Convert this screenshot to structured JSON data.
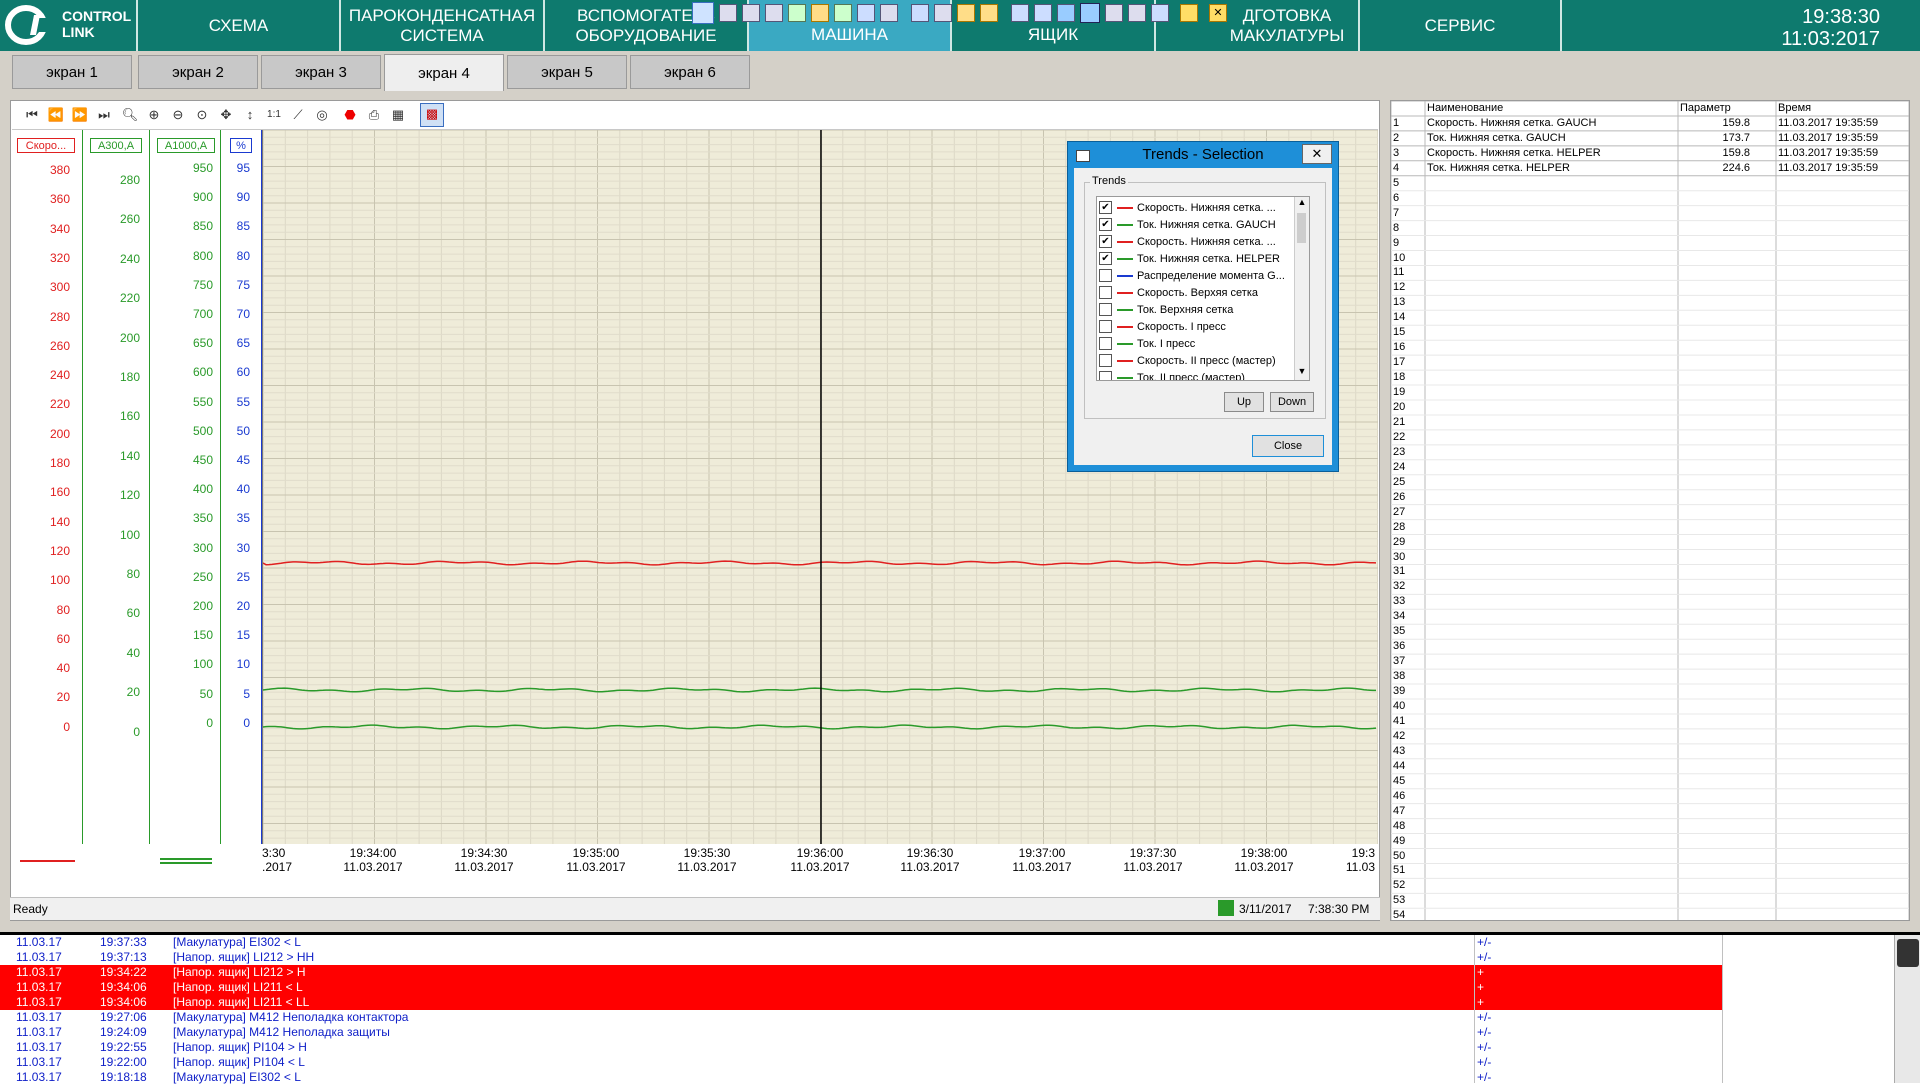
{
  "nav": {
    "logo": [
      "CONTROL",
      "LINK"
    ],
    "items": [
      {
        "label": "СХЕМА"
      },
      {
        "label": "ПАРОКОНДЕНСАТНАЯ СИСТЕМА"
      },
      {
        "label": "ВСПОМОГАТЕЛЬ ОБОРУДОВАНИЕ"
      },
      {
        "label": "МАШИНА",
        "active": true
      },
      {
        "label": "ЯЩИК"
      },
      {
        "label": "ДГОТОВКА МАКУЛАТУРЫ"
      },
      {
        "label": "СЕРВИС"
      }
    ],
    "time": "19:38:30",
    "date": "11:03:2017"
  },
  "tabs": [
    "экран 1",
    "экран 2",
    "экран 3",
    "экран 4",
    "экран 5",
    "экран 6"
  ],
  "active_tab": "экран 4",
  "axes": {
    "boxes": [
      "Скоро...",
      "A300,A",
      "A1000,A",
      "%"
    ],
    "axis1": [
      "380",
      "360",
      "340",
      "320",
      "300",
      "280",
      "260",
      "240",
      "220",
      "200",
      "180",
      "160",
      "140",
      "120",
      "100",
      "80",
      "60",
      "40",
      "20",
      "0"
    ],
    "axis2": [
      "280",
      "260",
      "240",
      "220",
      "200",
      "180",
      "160",
      "140",
      "120",
      "100",
      "80",
      "60",
      "40",
      "20",
      "0"
    ],
    "axis3": [
      "950",
      "900",
      "850",
      "800",
      "750",
      "700",
      "650",
      "600",
      "550",
      "500",
      "450",
      "400",
      "350",
      "300",
      "250",
      "200",
      "150",
      "100",
      "50",
      "0"
    ],
    "axis4": [
      "95",
      "90",
      "85",
      "80",
      "75",
      "70",
      "65",
      "60",
      "55",
      "50",
      "45",
      "40",
      "35",
      "30",
      "25",
      "20",
      "15",
      "10",
      "5",
      "0"
    ],
    "x_times": [
      "3:30",
      "19:34:00",
      "19:34:30",
      "19:35:00",
      "19:35:30",
      "19:36:00",
      "19:36:30",
      "19:37:00",
      "19:37:30",
      "19:38:00",
      "19:3"
    ],
    "x_dates": [
      ".2017",
      "11.03.2017",
      "11.03.2017",
      "11.03.2017",
      "11.03.2017",
      "11.03.2017",
      "11.03.2017",
      "11.03.2017",
      "11.03.2017",
      "11.03.2017",
      "11.03"
    ]
  },
  "colors": {
    "red": "#e02020",
    "green": "#2a9a2a",
    "blue": "#1a3ad0",
    "nav": "#0e7a6e"
  },
  "status": {
    "left": "Ready",
    "date": "3/11/2017",
    "time": "7:38:30 PM"
  },
  "dialog": {
    "title": "Trends - Selection",
    "close_x": "✕",
    "group": "Trends",
    "items": [
      {
        "label": "Скорость. Нижняя сетка. ...",
        "checked": true,
        "color": "#e02020"
      },
      {
        "label": "Ток. Нижняя сетка. GAUCH",
        "checked": true,
        "color": "#2a9a2a"
      },
      {
        "label": "Скорость. Нижняя сетка. ...",
        "checked": true,
        "color": "#e02020"
      },
      {
        "label": "Ток. Нижняя сетка. HELPER",
        "checked": true,
        "color": "#2a9a2a"
      },
      {
        "label": "Распределение момента G...",
        "checked": false,
        "color": "#1a3ad0"
      },
      {
        "label": "Скорость. Верхяя сетка",
        "checked": false,
        "color": "#e02020"
      },
      {
        "label": "Ток. Верхняя сетка",
        "checked": false,
        "color": "#2a9a2a"
      },
      {
        "label": "Скорость. I пресс",
        "checked": false,
        "color": "#e02020"
      },
      {
        "label": "Ток. I пресс",
        "checked": false,
        "color": "#2a9a2a"
      },
      {
        "label": "Скорость. II пресс (мастер)",
        "checked": false,
        "color": "#e02020"
      },
      {
        "label": "Ток. II пресс (мастер)",
        "checked": false,
        "color": "#2a9a2a"
      }
    ],
    "up": "Up",
    "down": "Down",
    "close": "Close"
  },
  "table": {
    "headers": [
      "Наименование",
      "Параметр",
      "Время"
    ],
    "rows": [
      {
        "n": "1",
        "name": "Скорость. Нижняя сетка. GAUCH",
        "value": "159.8",
        "time": "11.03.2017 19:35:59"
      },
      {
        "n": "2",
        "name": "Ток. Нижняя сетка. GAUCH",
        "value": "173.7",
        "time": "11.03.2017 19:35:59"
      },
      {
        "n": "3",
        "name": "Скорость. Нижняя сетка. HELPER",
        "value": "159.8",
        "time": "11.03.2017 19:35:59"
      },
      {
        "n": "4",
        "name": "Ток. Нижняя сетка. HELPER",
        "value": "224.6",
        "time": "11.03.2017 19:35:59"
      }
    ],
    "empty_rows": [
      "5",
      "6",
      "7",
      "8",
      "9",
      "10",
      "11",
      "12",
      "13",
      "14",
      "15",
      "16",
      "17",
      "18",
      "19",
      "20",
      "21",
      "22",
      "23",
      "24",
      "25",
      "26",
      "27",
      "28",
      "29",
      "30",
      "31",
      "32",
      "33",
      "34",
      "35",
      "36",
      "37",
      "38",
      "39",
      "40",
      "41",
      "42",
      "43",
      "44",
      "45",
      "46",
      "47",
      "48",
      "49",
      "50",
      "51",
      "52",
      "53",
      "54"
    ]
  },
  "alarms": [
    {
      "date": "11.03.17",
      "time": "19:37:33",
      "text": "[Макулатура] EI302 < L",
      "sign": "+/-",
      "red": false
    },
    {
      "date": "11.03.17",
      "time": "19:37:13",
      "text": "[Напор. ящик] LI212 > HH",
      "sign": "+/-",
      "red": false
    },
    {
      "date": "11.03.17",
      "time": "19:34:22",
      "text": "[Напор. ящик] LI212 > H",
      "sign": "+",
      "red": true
    },
    {
      "date": "11.03.17",
      "time": "19:34:06",
      "text": "[Напор. ящик] LI211 < L",
      "sign": "+",
      "red": true
    },
    {
      "date": "11.03.17",
      "time": "19:34:06",
      "text": "[Напор. ящик] LI211 < LL",
      "sign": "+",
      "red": true
    },
    {
      "date": "11.03.17",
      "time": "19:27:06",
      "text": "[Макулатура] M412 Неполадка контактора",
      "sign": "+/-",
      "red": false
    },
    {
      "date": "11.03.17",
      "time": "19:24:09",
      "text": "[Макулатура] M412 Неполадка защиты",
      "sign": "+/-",
      "red": false
    },
    {
      "date": "11.03.17",
      "time": "19:22:55",
      "text": "[Напор. ящик] PI104 > H",
      "sign": "+/-",
      "red": false
    },
    {
      "date": "11.03.17",
      "time": "19:22:00",
      "text": "[Напор. ящик] PI104 < L",
      "sign": "+/-",
      "red": false
    },
    {
      "date": "11.03.17",
      "time": "19:18:18",
      "text": "[Макулатура] EI302 < L",
      "sign": "+/-",
      "red": false
    }
  ],
  "icons": {
    "toolbar": [
      "first-icon",
      "prev-icon",
      "next-icon",
      "last-icon",
      "zoom-icon",
      "zoom-in-icon",
      "zoom-out-icon",
      "zoom-area-icon",
      "pan-icon",
      "vertical-fit-icon",
      "one-to-one-icon",
      "chart-line-icon",
      "target-icon",
      "stop-icon",
      "print-icon",
      "export-icon",
      "trend-select-icon"
    ]
  }
}
